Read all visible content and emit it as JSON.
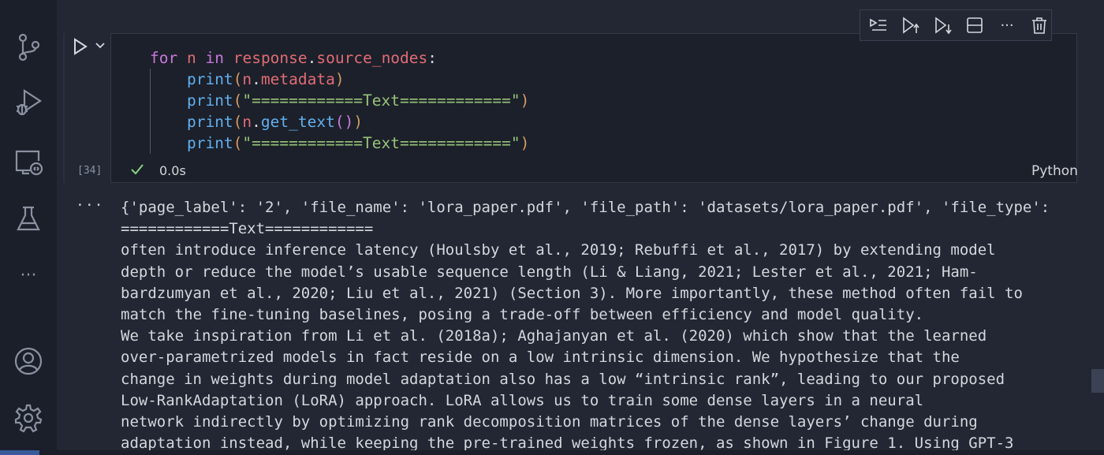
{
  "activity_bar": {
    "icons": [
      "source-control-icon",
      "run-debug-icon",
      "remote-explorer-icon",
      "testing-flask-icon",
      "more-icon",
      "account-icon",
      "settings-gear-icon"
    ],
    "more_label": "···"
  },
  "toolbar": {
    "icons": [
      "execute-above-icon",
      "execute-cell-and-above-icon",
      "execute-cell-and-below-icon",
      "split-cell-icon",
      "more-actions-icon",
      "delete-cell-icon"
    ],
    "more_label": "···"
  },
  "cell": {
    "code_lines": [
      "for n in response.source_nodes:",
      "    print(n.metadata)",
      "    print(\"============Text============\")",
      "    print(n.get_text())",
      "    print(\"============Text============\")"
    ],
    "tokens": {
      "for": "for",
      "n": "n",
      "in": "in",
      "response": "response",
      "dot": ".",
      "source_nodes": "source_nodes",
      "colon": ":",
      "print": "print",
      "lparen": "(",
      "rparen": ")",
      "metadata": "metadata",
      "separator": "\"============Text============\"",
      "get_text": "get_text",
      "empty_call": "()"
    },
    "execution_count": "[34]",
    "status": "success",
    "exec_time": "0.0s",
    "language": "Python"
  },
  "output": {
    "dots_label": "···",
    "lines": [
      "{'page_label': '2', 'file_name': 'lora_paper.pdf', 'file_path': 'datasets/lora_paper.pdf', 'file_type':",
      "============Text============",
      "often introduce inference latency (Houlsby et al., 2019; Rebuffi et al., 2017) by extending model",
      "depth or reduce the model’s usable sequence length (Li & Liang, 2021; Lester et al., 2021; Ham-",
      "bardzumyan et al., 2020; Liu et al., 2021) (Section 3). More importantly, these method often fail to",
      "match the fine-tuning baselines, posing a trade-off between efficiency and model quality.",
      "We take inspiration from Li et al. (2018a); Aghajanyan et al. (2020) which show that the learned",
      "over-parametrized models in fact reside on a low intrinsic dimension. We hypothesize that the",
      "change in weights during model adaptation also has a low “intrinsic rank”, leading to our proposed",
      "Low-RankAdaptation (LoRA) approach. LoRA allows us to train some dense layers in a neural",
      "network indirectly by optimizing rank decomposition matrices of the dense layers’ change during",
      "adaptation instead, while keeping the pre-trained weights frozen, as shown in Figure 1. Using GPT-3"
    ]
  },
  "colors": {
    "keyword": "#c678dd",
    "variable": "#e06c75",
    "function": "#61afef",
    "string": "#98c379",
    "success": "#89d185"
  }
}
